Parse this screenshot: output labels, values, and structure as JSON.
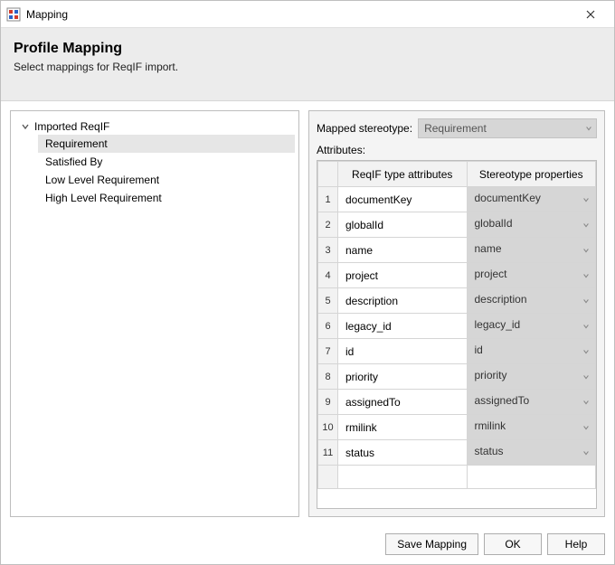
{
  "window": {
    "title": "Mapping"
  },
  "header": {
    "heading": "Profile Mapping",
    "subtitle": "Select mappings for ReqIF import."
  },
  "tree": {
    "root": "Imported ReqIF",
    "items": [
      "Requirement",
      "Satisfied By",
      "Low Level Requirement",
      "High Level Requirement"
    ],
    "selected_index": 0
  },
  "right": {
    "stereo_label": "Mapped stereotype:",
    "stereo_value": "Requirement",
    "attributes_label": "Attributes:",
    "columns": {
      "reqif": "ReqIF type attributes",
      "stereo": "Stereotype properties"
    },
    "rows": [
      {
        "reqif": "documentKey",
        "stereo": "documentKey"
      },
      {
        "reqif": "globalId",
        "stereo": "globalId"
      },
      {
        "reqif": "name",
        "stereo": "name"
      },
      {
        "reqif": "project",
        "stereo": "project"
      },
      {
        "reqif": "description",
        "stereo": "description"
      },
      {
        "reqif": "legacy_id",
        "stereo": "legacy_id"
      },
      {
        "reqif": "id",
        "stereo": "id"
      },
      {
        "reqif": "priority",
        "stereo": "priority"
      },
      {
        "reqif": "assignedTo",
        "stereo": "assignedTo"
      },
      {
        "reqif": "rmilink",
        "stereo": "rmilink"
      },
      {
        "reqif": "status",
        "stereo": "status"
      }
    ]
  },
  "footer": {
    "save": "Save Mapping",
    "ok": "OK",
    "help": "Help"
  }
}
